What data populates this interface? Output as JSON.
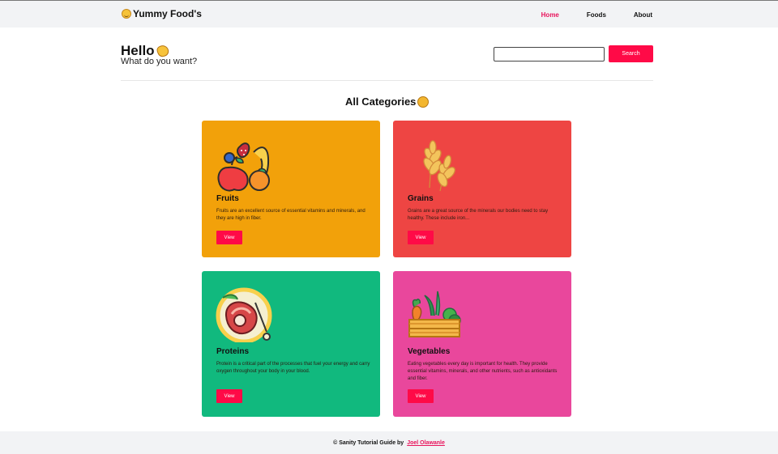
{
  "brand": {
    "name": "Yummy Food's",
    "emoji_icon": "smiling-face-icon"
  },
  "nav": {
    "items": [
      "Home",
      "Foods",
      "About"
    ],
    "active": "Home"
  },
  "hero": {
    "title": "Hello",
    "subtitle": "What do you want?",
    "icon": "waving-hand-icon"
  },
  "search": {
    "placeholder": "",
    "button_label": "Search"
  },
  "section": {
    "title": "All Categories",
    "icon": "food-bowl-icon"
  },
  "cards": [
    {
      "title": "Fruits",
      "description": "Fruits are an excellent source of essential vitamins and minerals, and they are high in fiber.",
      "button": "View",
      "icon": "fruit-illustration-icon",
      "color": "#f2a10a"
    },
    {
      "title": "Grains",
      "description": "Grains are a great source of the minerals our bodies need to stay healthy. These include iron...",
      "button": "View",
      "icon": "wheat-illustration-icon",
      "color": "#ee4543"
    },
    {
      "title": "Proteins",
      "description": "Protein is a critical part of the processes that fuel your energy and carry oxygen throughout your body in your blood.",
      "button": "View",
      "icon": "meat-illustration-icon",
      "color": "#11b97e"
    },
    {
      "title": "Vegetables",
      "description": "Eating vegetables every day is important for health. They provide essential vitamins, minerals, and other nutrients, such as antioxidants and fiber.",
      "button": "View",
      "icon": "vegetable-crate-illustration-icon",
      "color": "#e9479c"
    }
  ],
  "footer": {
    "text": "© Sanity Tutorial Guide by",
    "author": "Joel Olawanle"
  },
  "colors": {
    "accent": "#ff0a47",
    "link_active": "#e8135b",
    "background": "#ffffff",
    "bar": "#f2f3f5"
  }
}
